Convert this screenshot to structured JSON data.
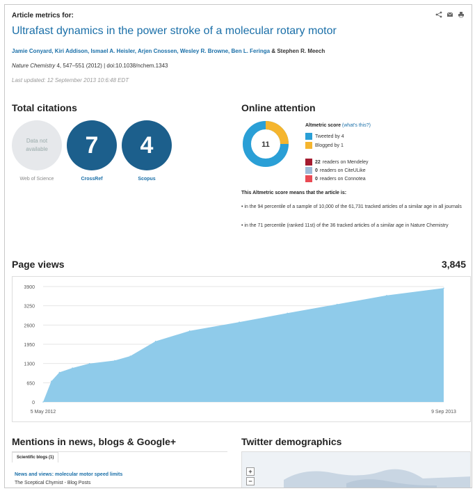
{
  "header": {
    "kicker": "Article metrics for:",
    "title": "Ultrafast dynamics in the power stroke of a molecular rotary motor",
    "authors": "Jamie Conyard, Kiri Addison, Ismael A. Heisler, Arjen Cnossen, Wesley R. Browne, Ben L. Feringa",
    "authors_amp": "& Stephen R. Meech",
    "journal": "Nature Chemistry",
    "citation_rest": "4, 547–551 (2012)  |  doi:10.1038/nchem.1343",
    "last_updated": "Last updated: 12 September 2013 10:6:48 EDT"
  },
  "icons": [
    "share-icon",
    "email-icon",
    "print-icon"
  ],
  "citations": {
    "heading": "Total citations",
    "wos": {
      "text_line1": "Data not",
      "text_line2": "available",
      "label": "Web of Science"
    },
    "crossref": {
      "value": "7",
      "label": "CrossRef"
    },
    "scopus": {
      "value": "4",
      "label": "Scopus"
    }
  },
  "online": {
    "heading": "Online attention",
    "score": "11",
    "altmetric_title": "Altmetric score",
    "whats_this": "(what's this?)",
    "legend": [
      {
        "label": "Tweeted by 4",
        "color": "#2a9fd6"
      },
      {
        "label": "Blogged by 1",
        "color": "#f5b52e"
      }
    ],
    "readers": [
      {
        "count": "22",
        "label": "readers on Mendeley",
        "color": "#a51c30"
      },
      {
        "count": "0",
        "label": "readers on CiteULike",
        "color": "#9ebbd8"
      },
      {
        "count": "0",
        "label": "readers on Connotea",
        "color": "#e94a54"
      }
    ],
    "means_heading": "This Altmetric score means that the article is:",
    "bullet1": "• in the 94 percentile of a sample of 10,000 of the 61,731 tracked articles of a similar age in all journals",
    "bullet2": "• in the 71 percentile (ranked 11st) of the 36 tracked articles of a similar age in Nature Chemistry"
  },
  "pageviews": {
    "heading": "Page views",
    "total": "3,845"
  },
  "chart_data": {
    "type": "area",
    "title": "",
    "xlabel": "",
    "ylabel": "",
    "x_start_label": "5 May 2012",
    "x_end_label": "9 Sep 2013",
    "yticks": [
      "0",
      "650",
      "1300",
      "1950",
      "2600",
      "3250",
      "3900"
    ],
    "ylim": [
      0,
      3900
    ],
    "x": [
      "2012-05-05",
      "2012-05-15",
      "2012-05-25",
      "2012-06-10",
      "2012-07-01",
      "2012-08-01",
      "2012-08-20",
      "2012-09-20",
      "2012-11-01",
      "2013-01-01",
      "2013-03-01",
      "2013-05-01",
      "2013-07-01",
      "2013-09-09"
    ],
    "values": [
      0,
      700,
      1000,
      1150,
      1300,
      1400,
      1550,
      2050,
      2400,
      2700,
      3000,
      3300,
      3600,
      3845
    ],
    "color": "#8fcbea",
    "grid": true
  },
  "mentions": {
    "heading": "Mentions in news, blogs & Google+",
    "tab": "Scientific blogs (1)",
    "blog_title": "News and views: molecular motor speed limits",
    "blog_source": "The Sceptical Chymist - Blog Posts"
  },
  "twitter": {
    "heading": "Twitter demographics",
    "zoom_in": "+",
    "zoom_out": "−"
  }
}
